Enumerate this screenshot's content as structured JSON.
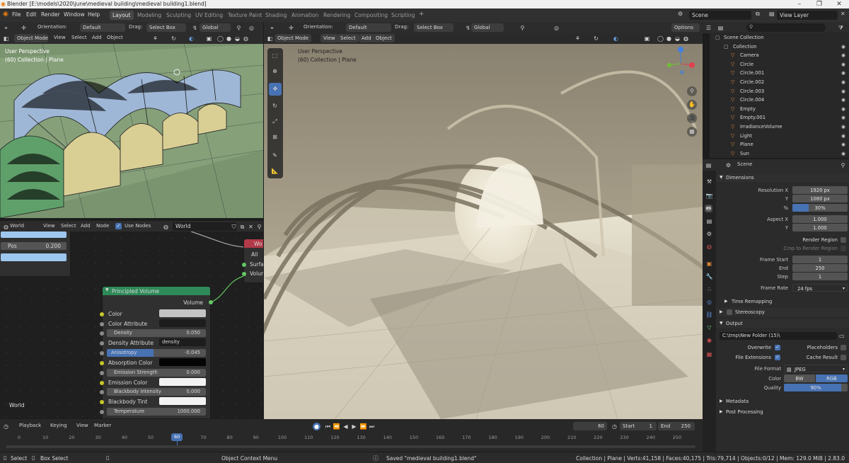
{
  "window": {
    "title": "Blender [E:\\models\\2020\\june\\medieval building\\medieval building1.blend]"
  },
  "menu": [
    "File",
    "Edit",
    "Render",
    "Window",
    "Help"
  ],
  "workspaces": [
    "Layout",
    "Modeling",
    "Sculpting",
    "UV Editing",
    "Texture Paint",
    "Shading",
    "Animation",
    "Rendering",
    "Compositing",
    "Scripting"
  ],
  "active_workspace": "Layout",
  "scene_name": "Scene",
  "view_layer": "View Layer",
  "left_viewport": {
    "orientation_label": "Orientation:",
    "orientation": "Default",
    "drag_label": "Drag:",
    "drag": "Select Box",
    "transform": "Global",
    "mode": "Object Mode",
    "menus": [
      "View",
      "Select",
      "Add",
      "Object"
    ],
    "overlay_title": "User Perspective",
    "overlay_sub": "(60) Collection | Plane"
  },
  "main_viewport": {
    "orientation_label": "Orientation:",
    "orientation": "Default",
    "drag_label": "Drag:",
    "drag": "Select Box",
    "transform": "Global",
    "options": "Options",
    "mode": "Object Mode",
    "menus": [
      "View",
      "Select",
      "Add",
      "Object"
    ],
    "overlay_title": "User Perspective",
    "overlay_sub": "(60) Collection | Plane"
  },
  "node_editor": {
    "type": "World",
    "menus": [
      "View",
      "Select",
      "Add",
      "Node"
    ],
    "use_nodes": "Use Nodes",
    "world_name": "World",
    "footer_label": "World",
    "ramp_pos_label": "Pos",
    "ramp_pos_value": "0.200",
    "output_node": {
      "title": "Wo",
      "target": "All",
      "surface": "Surfac",
      "volume": "Volum"
    },
    "principled_volume": {
      "title": "Principled Volume",
      "output": "Volume",
      "rows": [
        {
          "label": "Color",
          "value": ""
        },
        {
          "label": "Color Attribute",
          "value": ""
        },
        {
          "label": "Density",
          "value": "0.050"
        },
        {
          "label": "Density Attribute",
          "value": "density"
        },
        {
          "label": "Anisotropy",
          "value": "-0.045"
        },
        {
          "label": "Absorption Color",
          "value": ""
        },
        {
          "label": "Emission Strength",
          "value": "0.000"
        },
        {
          "label": "Emission Color",
          "value": ""
        },
        {
          "label": "Blackbody Intensity",
          "value": "0.000"
        },
        {
          "label": "Blackbody Tint",
          "value": ""
        },
        {
          "label": "Temperature",
          "value": "1000.000"
        }
      ]
    }
  },
  "outliner": {
    "root": "Scene Collection",
    "items": [
      {
        "name": "Collection",
        "color": "#cfcfcf"
      },
      {
        "name": "Camera",
        "color": "#e08a3a"
      },
      {
        "name": "Circle",
        "color": "#e08a3a"
      },
      {
        "name": "Circle.001",
        "color": "#e08a3a"
      },
      {
        "name": "Circle.002",
        "color": "#e08a3a"
      },
      {
        "name": "Circle.003",
        "color": "#e08a3a"
      },
      {
        "name": "Circle.004",
        "color": "#e08a3a"
      },
      {
        "name": "Empty",
        "color": "#e08a3a"
      },
      {
        "name": "Empty.001",
        "color": "#e08a3a"
      },
      {
        "name": "IrradianceVolume",
        "color": "#e08a3a"
      },
      {
        "name": "Light",
        "color": "#e08a3a"
      },
      {
        "name": "Plane",
        "color": "#e08a3a"
      },
      {
        "name": "Sun",
        "color": "#e08a3a"
      }
    ]
  },
  "properties": {
    "context": "Scene",
    "dimensions": {
      "title": "Dimensions",
      "resolution_x_label": "Resolution X",
      "resolution_x": "1920 px",
      "resolution_y_label": "Y",
      "resolution_y": "1080 px",
      "percent_label": "%",
      "percent": "30%",
      "percent_fill": 0.3,
      "aspect_x_label": "Aspect X",
      "aspect_x": "1.000",
      "aspect_y_label": "Y",
      "aspect_y": "1.000",
      "render_region": "Render Region",
      "crop_region": "Crop to Render Region",
      "frame_start_label": "Frame Start",
      "frame_start": "1",
      "end_label": "End",
      "end": "250",
      "step_label": "Step",
      "step": "1",
      "frame_rate_label": "Frame Rate",
      "frame_rate": "24 fps"
    },
    "time_remapping": "Time Remapping",
    "stereoscopy": "Stereoscopy",
    "output": {
      "title": "Output",
      "path": "C:\\tmp\\New Folder (15)\\",
      "overwrite": "Overwrite",
      "placeholders": "Placeholders",
      "file_extensions": "File Extensions",
      "cache_result": "Cache Result",
      "file_format_label": "File Format",
      "file_format": "JPEG",
      "color_label": "Color",
      "color_bw": "BW",
      "color_rgb": "RGB",
      "quality_label": "Quality",
      "quality": "90%",
      "quality_fill": 0.9
    },
    "metadata": "Metadata",
    "post_processing": "Post Processing"
  },
  "timeline": {
    "menus": [
      "Playback",
      "Keying",
      "View",
      "Marker"
    ],
    "current_frame": "60",
    "start_label": "Start",
    "start": "1",
    "end_label": "End",
    "end": "250",
    "ticks": [
      "0",
      "10",
      "20",
      "30",
      "40",
      "50",
      "60",
      "70",
      "80",
      "90",
      "100",
      "110",
      "120",
      "130",
      "140",
      "150",
      "160",
      "170",
      "180",
      "190",
      "200",
      "210",
      "220",
      "230",
      "240",
      "250"
    ]
  },
  "statusbar": {
    "select": "Select",
    "box_select": "Box Select",
    "context_menu": "Object Context Menu",
    "message": "Saved \"medieval building1.blend\"",
    "stats": "Collection | Plane | Verts:41,158 | Faces:40,175 | Tris:79,714 | Objects:0/12 | Mem: 129.0 MiB | 2.83.0"
  },
  "colors": {
    "accent": "#4772b3",
    "node_header": "#2e8a58",
    "output_header": "#b23a48",
    "socket_yellow": "#c7c729",
    "socket_green": "#63c763",
    "gizmo_x": "#e04050",
    "gizmo_y": "#70c030",
    "gizmo_z": "#4080e0"
  }
}
